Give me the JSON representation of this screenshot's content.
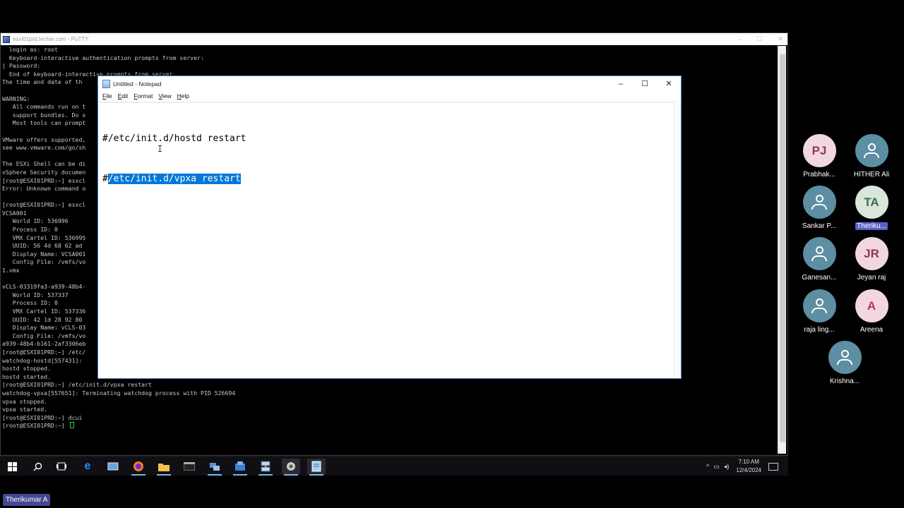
{
  "putty": {
    "title": "esxi01prd.techie.com - PuTTY",
    "lines": [
      "  login as: root",
      "  Keyboard-interactive authentication prompts from server:",
      "| Password:",
      "  End of keyboard-interactive prompts from server",
      "The time and date of th",
      "",
      "WARNING:",
      "   All commands run on t",
      "   support bundles. Do s",
      "   Most tools can prompt",
      "",
      "VMware offers supported,",
      "see www.vmware.com/go/sh",
      "",
      "The ESXi Shell can be di",
      "vSphere Security documen",
      "[root@ESXI01PRD:~] esxcl",
      "Error: Unknown command o",
      "",
      "[root@ESXI01PRD:~] esxcl",
      "VCSA001",
      "   World ID: 536996",
      "   Process ID: 0",
      "   VMX Cartel ID: 536995",
      "   UUID: 56 4d 68 62 ad",
      "   Display Name: VCSA001",
      "   Config File: /vmfs/vo",
      "1.vmx",
      "",
      "vCLS-03319fa3-a939-48b4-",
      "   World ID: 537337",
      "   Process ID: 0",
      "   VMX Cartel ID: 537336",
      "   UUID: 42 1d 28 92 80",
      "   Display Name: vCLS-03",
      "   Config File: /vmfs/vo",
      "a939-48b4-b161-2af3306eb",
      "[root@ESXI01PRD:~] /etc/",
      "watchdog-hostd[557431]:",
      "hostd stopped.",
      "hostd started.",
      "[root@ESXI01PRD:~] /etc/init.d/vpxa restart",
      "watchdog-vpxa[557651]: Terminating watchdog process with PID 526694",
      "vpxa stopped.",
      "vpxa started.",
      "[root@ESXI01PRD:~] dcui",
      "[root@ESXI01PRD:~] "
    ]
  },
  "notepad": {
    "title": "Untitled - Notepad",
    "menu": [
      "File",
      "Edit",
      "Format",
      "View",
      "Help"
    ],
    "line1": "#/etc/init.d/hostd restart",
    "line2_prefix": "#",
    "line2_selected": "/etc/init.d/vpxa restart",
    "controls": {
      "minimize": "–",
      "maximize": "☐",
      "close": "✕"
    }
  },
  "taskbar": {
    "icons": [
      "windows-start-icon",
      "search-icon",
      "task-view-icon",
      "internet-explorer-icon",
      "server-manager-icon",
      "firefox-icon",
      "file-explorer-icon",
      "terminal-icon",
      "network-tool-icon",
      "folder-network-icon",
      "putty-icon",
      "gear-tool-icon",
      "notepad-icon"
    ],
    "time": "7:10 AM",
    "date": "12/4/2024"
  },
  "participants": [
    {
      "initials": "PJ",
      "name": "Prabhak...",
      "color": "#f2d7e0",
      "text_color": "#8a3a57"
    },
    {
      "initials": "",
      "name": "HITHER Ali",
      "color": "#5d8ea3"
    },
    {
      "initials": "",
      "name": "Sankar P...",
      "color": "#5d8ea3"
    },
    {
      "initials": "TA",
      "name": "Theriku...",
      "color": "#d9e6dc",
      "text_color": "#3e6e4a"
    },
    {
      "initials": "",
      "name": "Ganesan...",
      "color": "#5d8ea3"
    },
    {
      "initials": "JR",
      "name": "Jeyan raj",
      "color": "#f2d7e0",
      "text_color": "#8a3a57"
    },
    {
      "initials": "",
      "name": "raja ling...",
      "color": "#5d8ea3"
    },
    {
      "initials": "A",
      "name": "Areena",
      "color": "#f2d7e0",
      "text_color": "#c0305a"
    },
    {
      "initials": "",
      "name": "Krishna...",
      "color": "#5d8ea3"
    }
  ],
  "presenter_label": "Therikumar A"
}
